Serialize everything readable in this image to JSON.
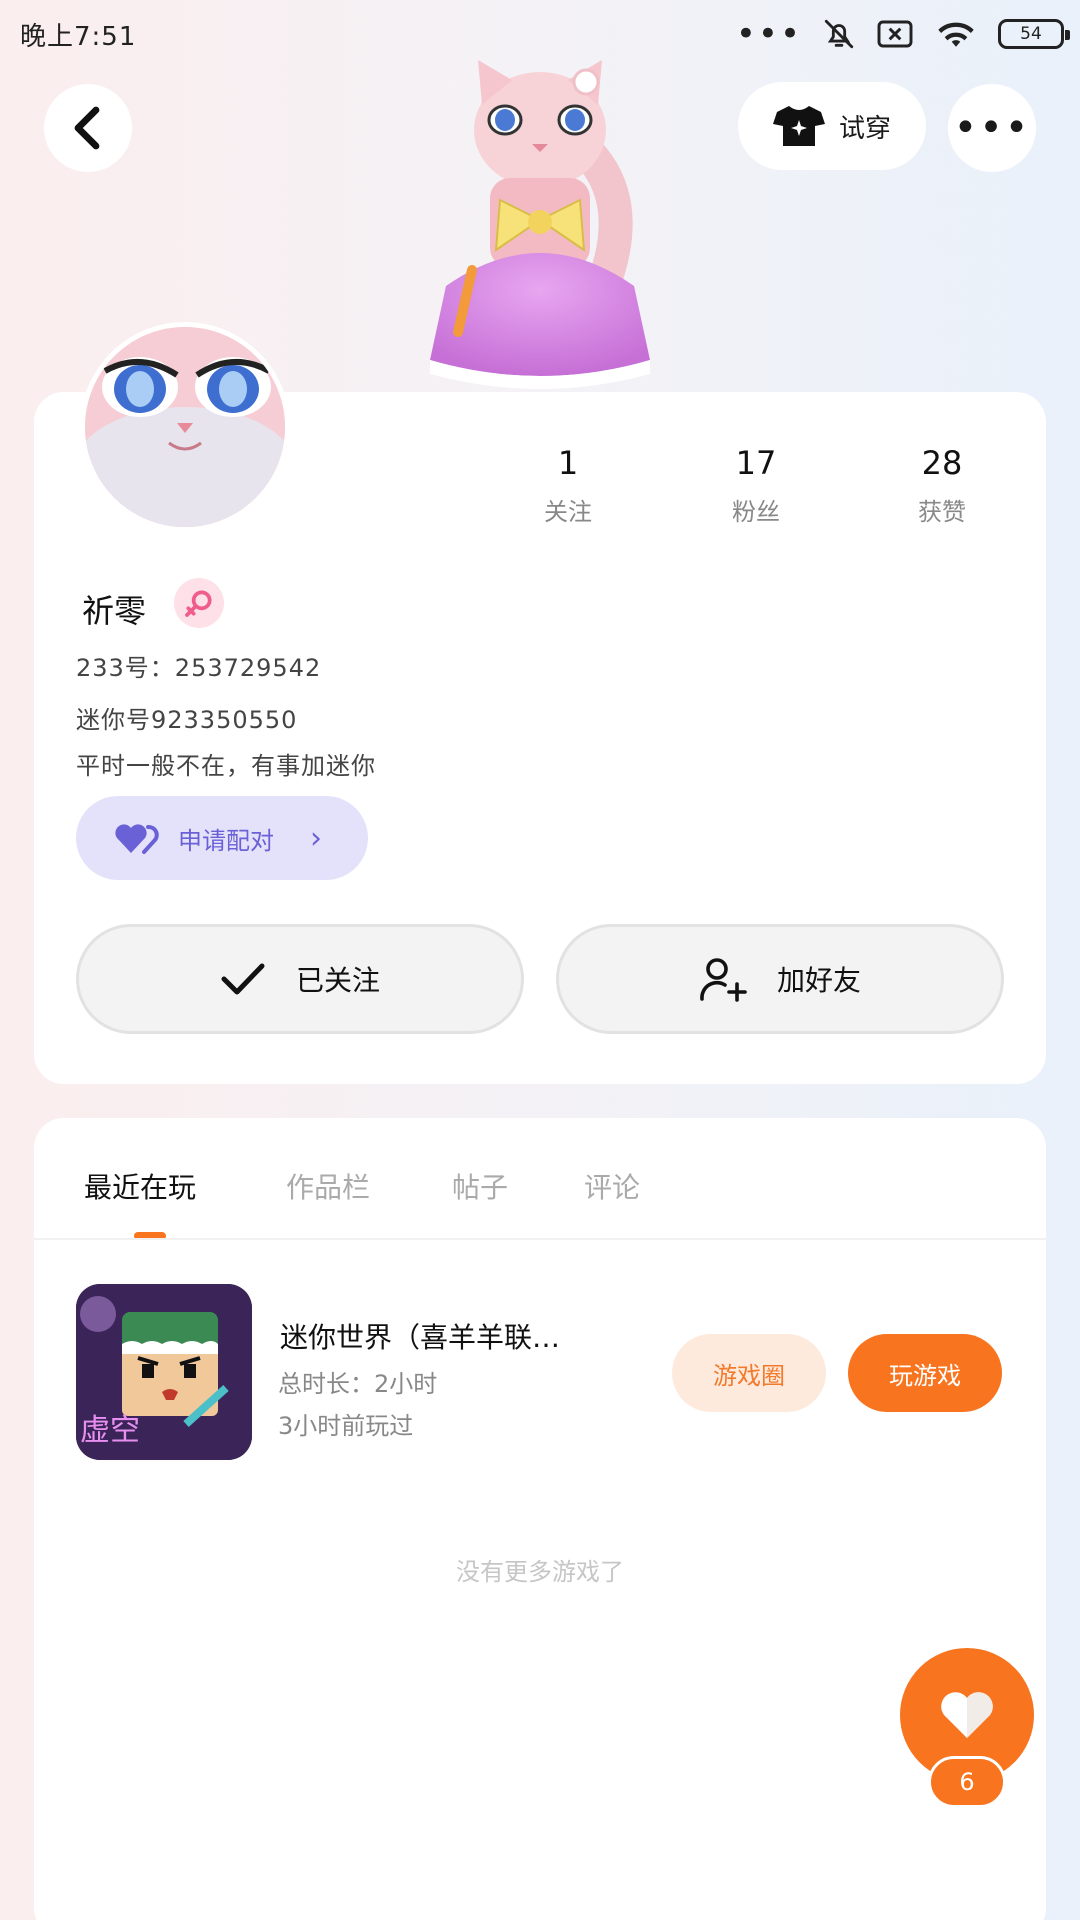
{
  "status_bar": {
    "time": "晚上7:51",
    "battery": "54",
    "icons": [
      "more-dots-icon",
      "bell-off-icon",
      "close-box-icon",
      "wifi-icon",
      "battery-icon"
    ]
  },
  "header": {
    "try_on_label": "试穿",
    "more_label": "•••"
  },
  "profile": {
    "stats": [
      {
        "value": "1",
        "label": "关注"
      },
      {
        "value": "17",
        "label": "粉丝"
      },
      {
        "value": "28",
        "label": "获赞"
      }
    ],
    "username": "祈零",
    "id_233": "233号：253729542",
    "mini_id": "迷你号923350550",
    "bio": "平时一般不在，有事加迷你",
    "pair_button": "申请配对",
    "followed_button": "已关注",
    "add_friend_button": "加好友"
  },
  "tabs": [
    {
      "label": "最近在玩",
      "active": true
    },
    {
      "label": "作品栏",
      "active": false
    },
    {
      "label": "帖子",
      "active": false
    },
    {
      "label": "评论",
      "active": false
    }
  ],
  "recent_game": {
    "title": "迷你世界（喜羊羊联…",
    "duration": "总时长：2小时",
    "last_played": "3小时前玩过",
    "circle_button": "游戏圈",
    "play_button": "玩游戏",
    "icon_overlay_text": "虚空"
  },
  "no_more_text": "没有更多游戏了",
  "like_count": "6",
  "colors": {
    "accent": "#f8741f",
    "pair": "#6b61d6",
    "gender": "#ef5d8a"
  }
}
